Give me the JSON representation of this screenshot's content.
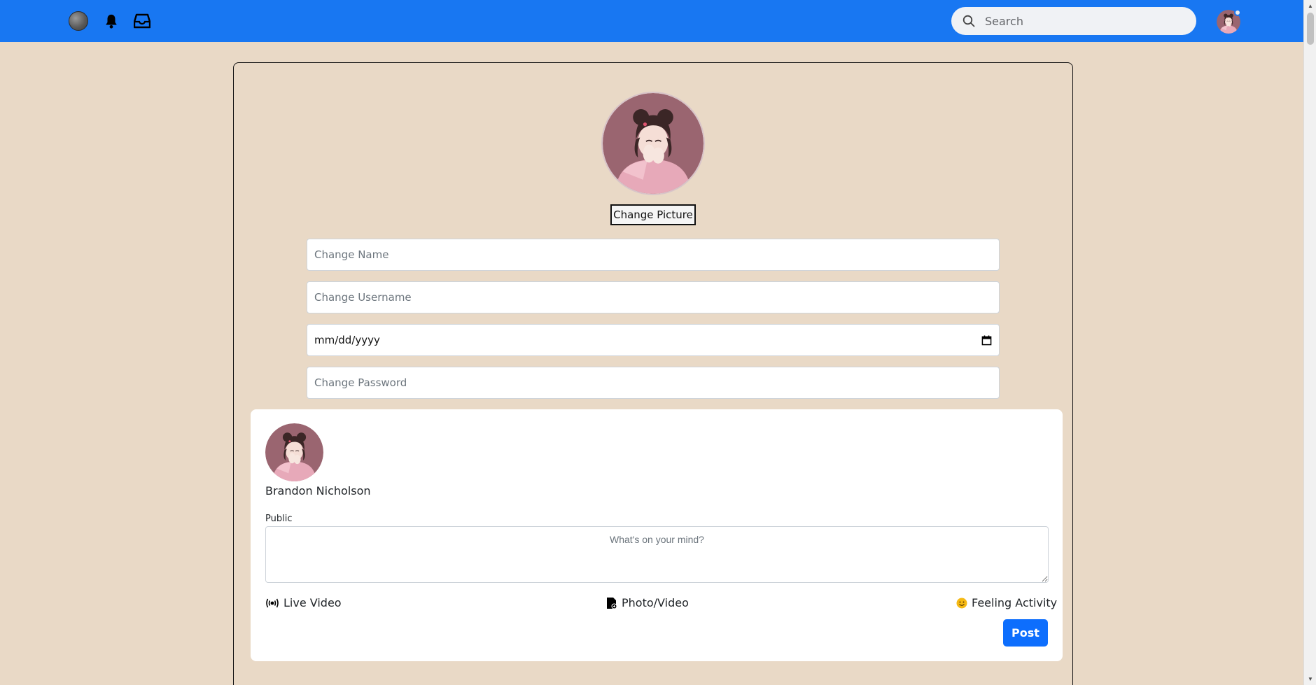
{
  "topbar": {
    "bg_color": "#1877f2",
    "icons": [
      "globe-icon",
      "bell-icon",
      "inbox-icon"
    ],
    "search_placeholder": "Search"
  },
  "profile": {
    "change_picture_label": "Change Picture",
    "name_placeholder": "Change Name",
    "username_placeholder": "Change Username",
    "date_value": "mm/dd/yyyy",
    "password_placeholder": "Change Password"
  },
  "composer": {
    "user_name": "Brandon Nicholson",
    "audience": "Public",
    "placeholder": "What's on your mind?",
    "actions": {
      "live_video": "Live Video",
      "photo_video": "Photo/Video",
      "feeling_activity": "Feeling Activity"
    },
    "post_label": "Post",
    "post_color": "#0d6efd"
  },
  "colors": {
    "page_bg": "#e9d9c6",
    "avatar_bg": "#9a6570"
  }
}
